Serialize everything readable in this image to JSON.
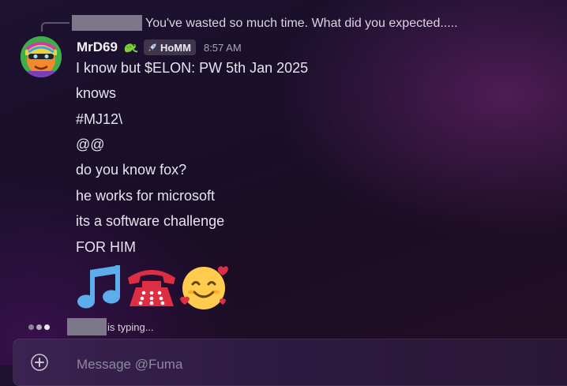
{
  "reply": {
    "text": "You've wasted so much time. What did you expected....."
  },
  "message": {
    "username": "MrD69",
    "user_emoji": "lizard-icon",
    "role_tag": {
      "icon": "rocket-icon",
      "label": "HoMM"
    },
    "timestamp": "8:57 AM",
    "lines": [
      "I know but $ELON: PW 5th Jan 2025",
      "knows",
      "#MJ12\\",
      "@@",
      "do you know fox?",
      "he works for microsoft",
      "its a software challenge",
      "FOR HIM"
    ],
    "emojis": [
      "musical-notes-icon",
      "telephone-icon",
      "smiling-face-with-hearts-icon"
    ]
  },
  "typing": {
    "text": "is typing..."
  },
  "composer": {
    "placeholder": "Message @Fuma"
  },
  "colors": {
    "username": "#f2f0f7",
    "timestamp": "#aaa5b8",
    "redacted": "#7d7889"
  }
}
